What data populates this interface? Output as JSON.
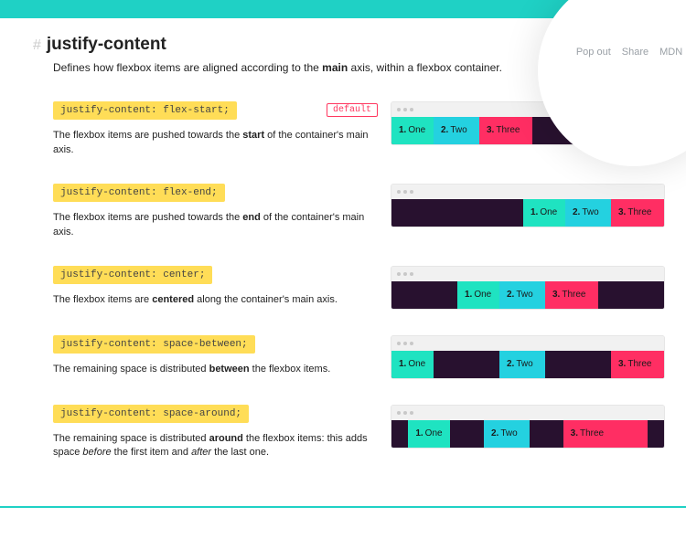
{
  "circle_menu": {
    "pop_out": "Pop out",
    "share": "Share",
    "mdn": "MDN"
  },
  "heading": {
    "hash": "#",
    "title": "justify-content"
  },
  "subtitle": {
    "pre": "Defines how flexbox items are aligned according to the ",
    "bold": "main",
    "post": " axis, within a flexbox container."
  },
  "default_label": "default",
  "items": {
    "one_num": "1.",
    "one": "One",
    "two_num": "2.",
    "two": "Two",
    "three_num": "3.",
    "three": "Three"
  },
  "ex1": {
    "code": "justify-content: flex-start;",
    "d_pre": "The flexbox items are pushed towards the ",
    "d_bold": "start",
    "d_post": " of the container's main axis."
  },
  "ex2": {
    "code": "justify-content: flex-end;",
    "d_pre": "The flexbox items are pushed towards the ",
    "d_bold": "end",
    "d_post": " of the container's main axis."
  },
  "ex3": {
    "code": "justify-content: center;",
    "d_pre": "The flexbox items are ",
    "d_bold": "centered",
    "d_post": " along the container's main axis."
  },
  "ex4": {
    "code": "justify-content: space-between;",
    "d_pre": "The remaining space is distributed ",
    "d_bold": "between",
    "d_post": " the flexbox items."
  },
  "ex5": {
    "code": "justify-content: space-around;",
    "d_pre": "The remaining space is distributed ",
    "d_bold": "around",
    "d_post": " the flexbox items: this adds space ",
    "d_em1": "before",
    "d_mid": " the first item and ",
    "d_em2": "after",
    "d_end": " the last one."
  }
}
